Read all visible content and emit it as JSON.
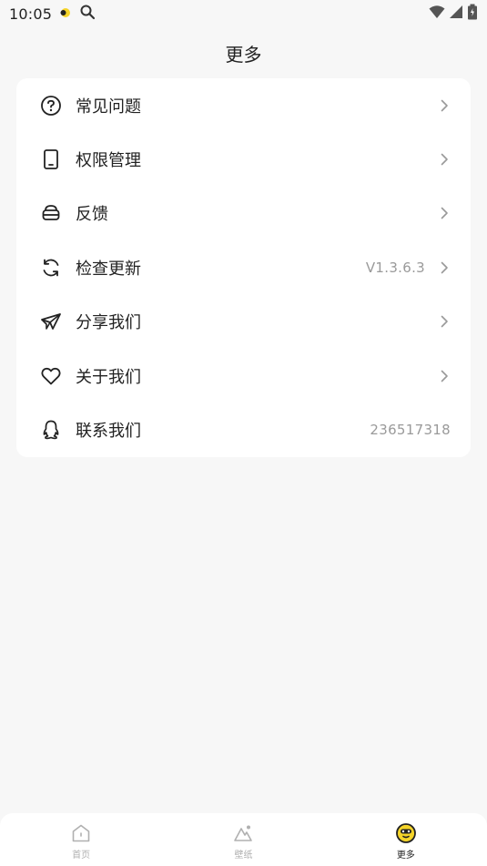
{
  "status_bar": {
    "time": "10:05",
    "icons": [
      "notification-dot-icon",
      "search-icon",
      "wifi-icon",
      "signal-icon",
      "battery-icon"
    ]
  },
  "header": {
    "title": "更多"
  },
  "menu": {
    "items": [
      {
        "label": "常见问题",
        "icon": "help-circle-icon",
        "value": "",
        "chevron": true
      },
      {
        "label": "权限管理",
        "icon": "phone-icon",
        "value": "",
        "chevron": true
      },
      {
        "label": "反馈",
        "icon": "feedback-box-icon",
        "value": "",
        "chevron": true
      },
      {
        "label": "检查更新",
        "icon": "refresh-icon",
        "value": "V1.3.6.3",
        "chevron": true
      },
      {
        "label": "分享我们",
        "icon": "paper-plane-icon",
        "value": "",
        "chevron": true
      },
      {
        "label": "关于我们",
        "icon": "heart-icon",
        "value": "",
        "chevron": true
      },
      {
        "label": "联系我们",
        "icon": "qq-icon",
        "value": "236517318",
        "chevron": false
      }
    ]
  },
  "bottom_nav": {
    "items": [
      {
        "label": "首页",
        "icon": "home-icon",
        "active": false
      },
      {
        "label": "壁纸",
        "icon": "wallpaper-icon",
        "active": false
      },
      {
        "label": "更多",
        "icon": "smiley-icon",
        "active": true
      }
    ]
  },
  "colors": {
    "background": "#f7f7f7",
    "card": "#ffffff",
    "text": "#222222",
    "muted": "#9a9a9a",
    "nav_inactive": "#b0b0b0",
    "accent_yellow": "#f5d42a"
  }
}
